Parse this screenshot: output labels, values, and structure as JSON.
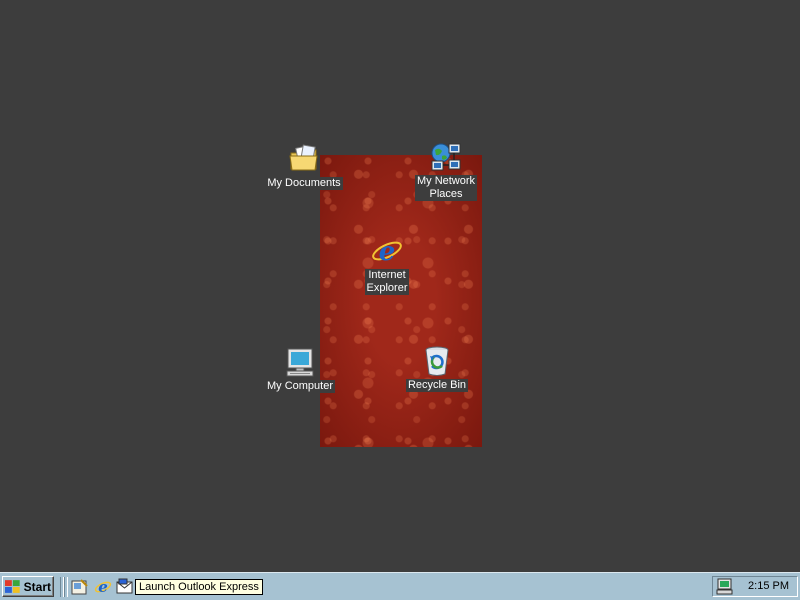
{
  "desktop": {
    "background_color": "#3d3d3d",
    "icons": [
      {
        "id": "my-documents",
        "label": "My Documents",
        "icon": "folder-documents-icon"
      },
      {
        "id": "my-network-places",
        "label": "My Network\nPlaces",
        "icon": "network-places-icon"
      },
      {
        "id": "internet-explorer",
        "label": "Internet\nExplorer",
        "icon": "internet-explorer-icon"
      },
      {
        "id": "my-computer",
        "label": "My Computer",
        "icon": "computer-icon"
      },
      {
        "id": "recycle-bin",
        "label": "Recycle Bin",
        "icon": "recycle-bin-icon"
      }
    ]
  },
  "taskbar": {
    "start_label": "Start",
    "quick_launch": [
      {
        "name": "show-desktop-icon"
      },
      {
        "name": "internet-explorer-icon"
      },
      {
        "name": "outlook-express-icon"
      }
    ],
    "tooltip": "Launch Outlook Express",
    "clock": "2:15 PM",
    "tray_icon": "display-settings-icon",
    "color": "#a6c2d2"
  }
}
